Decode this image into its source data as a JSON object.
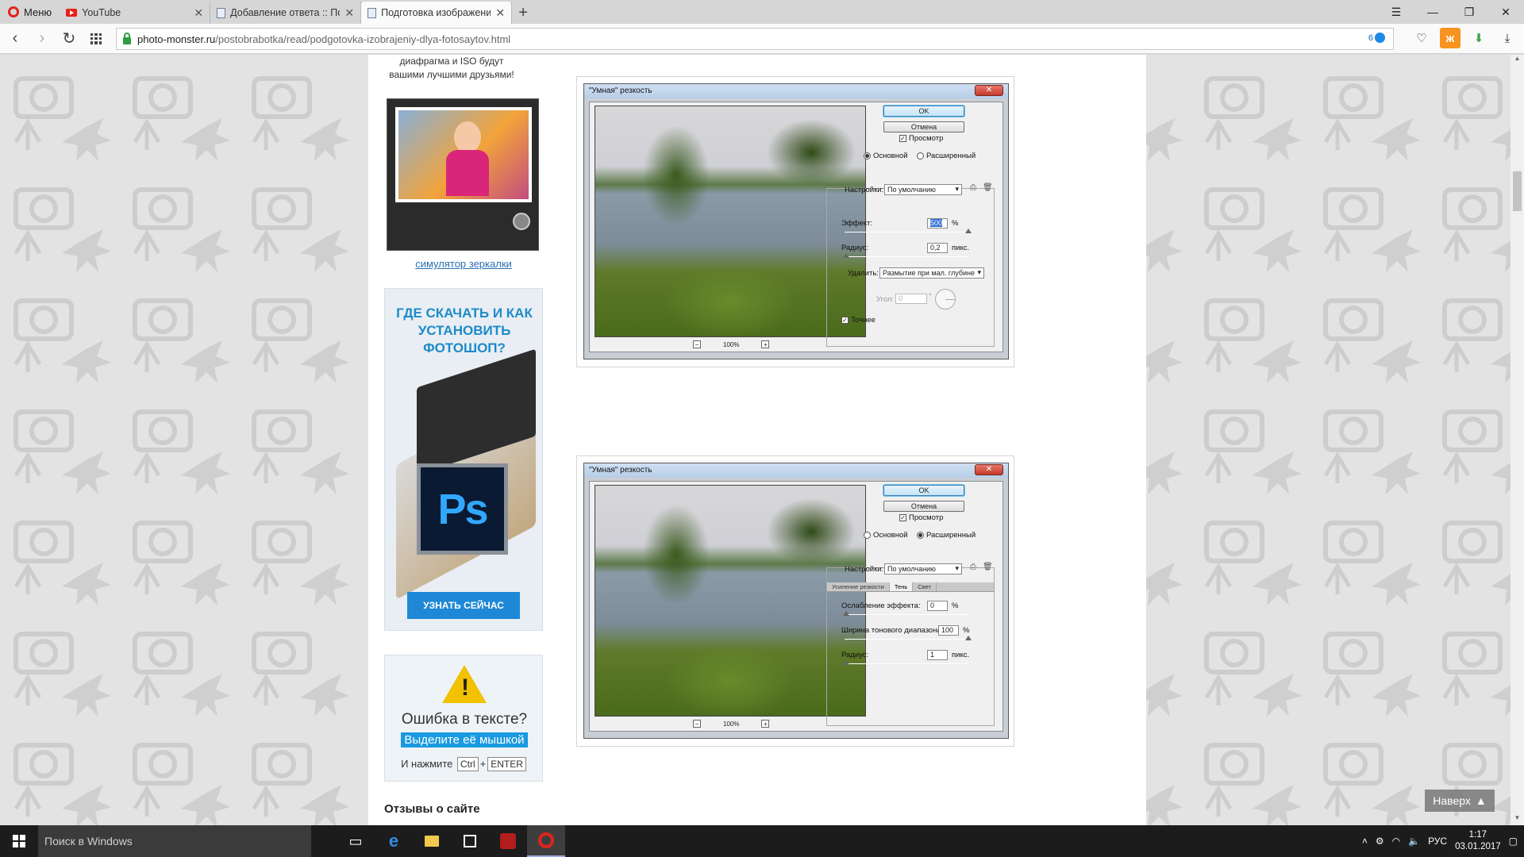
{
  "browser": {
    "menu_label": "Меню",
    "tabs": [
      {
        "title": "YouTube",
        "icon": "youtube-icon"
      },
      {
        "title": "Добавление ответа :: Пор",
        "icon": "page-icon"
      },
      {
        "title": "Подготовка изображений",
        "icon": "page-icon",
        "active": true
      }
    ],
    "url_host": "photo-monster.ru",
    "url_path": "/postobrabotka/read/podgotovka-izobrajeniy-dlya-fotosaytov.html",
    "vpn_count": "6"
  },
  "sidebar": {
    "intro_text": "диафрагма и ISO будут вашими лучшими друзьями!",
    "simulator_link": "симулятор зеркалки",
    "ps_ad": {
      "title": "ГДЕ СКАЧАТЬ И КАК УСТАНОВИТЬ ФОТОШОП?",
      "logo_text": "Ps",
      "button": "УЗНАТЬ СЕЙЧАС"
    },
    "error_box": {
      "title": "Ошибка в тексте?",
      "highlight": "Выделите её мышкой",
      "press": "И нажмите",
      "key1": "Ctrl",
      "plus": "+",
      "key2": "ENTER"
    },
    "reviews_heading": "Отзывы о сайте"
  },
  "dialog1": {
    "title": "\"Умная\" резкость",
    "ok": "OK",
    "cancel": "Отмена",
    "preview": "Просмотр",
    "basic": "Основной",
    "advanced": "Расширенный",
    "settings_label": "Настройки:",
    "settings_value": "По умолчанию",
    "amount_label": "Эффект:",
    "amount_value": "500",
    "amount_unit": "%",
    "radius_label": "Радиус:",
    "radius_value": "0,2",
    "radius_unit": "пикс.",
    "remove_label": "Удалить:",
    "remove_value": "Размытие при мал. глубине",
    "angle_label": "Угол:",
    "angle_value": "0",
    "angle_unit": "°",
    "accurate": "Точнее",
    "zoom": "100%",
    "zoom_out": "−",
    "zoom_in": "+",
    "amount_level": 1.0,
    "radius_level": 0.0
  },
  "dialog2": {
    "title": "\"Умная\" резкость",
    "ok": "OK",
    "cancel": "Отмена",
    "preview": "Просмотр",
    "basic": "Основной",
    "advanced": "Расширенный",
    "settings_label": "Настройки:",
    "settings_value": "По умолчанию",
    "tab_sharpen": "Усиление резкости",
    "tab_shadow": "Тень",
    "tab_highlight": "Свет",
    "fade_label": "Ослабление эффекта:",
    "fade_value": "0",
    "fade_unit": "%",
    "tonal_label": "Ширина тонового диапазона:",
    "tonal_value": "100",
    "tonal_unit": "%",
    "radius_label": "Радиус:",
    "radius_value": "1",
    "radius_unit": "пикс.",
    "zoom": "100%",
    "zoom_out": "−",
    "zoom_in": "+"
  },
  "page": {
    "top_button": "Наверх"
  },
  "taskbar": {
    "search_placeholder": "Поиск в Windows",
    "lang": "РУС",
    "time": "1:17",
    "date": "03.01.2017"
  },
  "colors": {
    "accent_blue": "#1e88d6",
    "opera_red": "#e0241b",
    "taskbar": "#1c1c1c"
  }
}
